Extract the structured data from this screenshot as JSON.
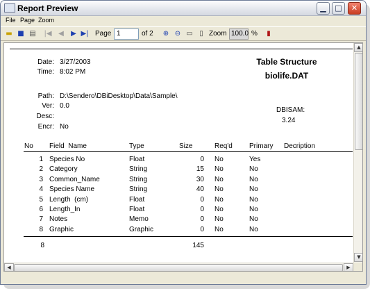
{
  "window": {
    "app_icon_text": "DBi",
    "title": "Report Preview"
  },
  "menu": [
    "File",
    "Page",
    "Zoom"
  ],
  "toolbar": {
    "page_label": "Page",
    "page_value": "1",
    "page_of": "of 2",
    "zoom_label": "Zoom",
    "zoom_value": "100.0",
    "zoom_unit": "%"
  },
  "report": {
    "date_key": "Date:",
    "date_val": "3/27/2003",
    "time_key": "Time:",
    "time_val": "8:02 PM",
    "path_key": "Path:",
    "path_val": "D:\\Sendero\\DBiDesktop\\Data\\Sample\\",
    "ver_key": "Ver:",
    "ver_val": "0.0",
    "desc_key": "Desc:",
    "desc_val": "",
    "encr_key": "Encr:",
    "encr_val": "No",
    "title1": "Table Structure",
    "title2": "biolife.DAT",
    "engine": "DBISAM:",
    "engine_ver": "3.24",
    "columns": [
      "No",
      "Field  Name",
      "Type",
      "Size",
      "Req'd",
      "Primary",
      "Decription"
    ],
    "rows": [
      {
        "no": "1",
        "name": "Species No",
        "type": "Float",
        "size": "0",
        "req": "No",
        "primary": "Yes"
      },
      {
        "no": "2",
        "name": "Category",
        "type": "String",
        "size": "15",
        "req": "No",
        "primary": "No"
      },
      {
        "no": "3",
        "name": "Common_Name",
        "type": "String",
        "size": "30",
        "req": "No",
        "primary": "No"
      },
      {
        "no": "4",
        "name": "Species Name",
        "type": "String",
        "size": "40",
        "req": "No",
        "primary": "No"
      },
      {
        "no": "5",
        "name": "Length  (cm)",
        "type": "Float",
        "size": "0",
        "req": "No",
        "primary": "No"
      },
      {
        "no": "6",
        "name": "Length_In",
        "type": "Float",
        "size": "0",
        "req": "No",
        "primary": "No"
      },
      {
        "no": "7",
        "name": "Notes",
        "type": "Memo",
        "size": "0",
        "req": "No",
        "primary": "No"
      },
      {
        "no": "8",
        "name": "Graphic",
        "type": "Graphic",
        "size": "0",
        "req": "No",
        "primary": "No"
      }
    ],
    "total_count": "8",
    "total_size": "145"
  }
}
